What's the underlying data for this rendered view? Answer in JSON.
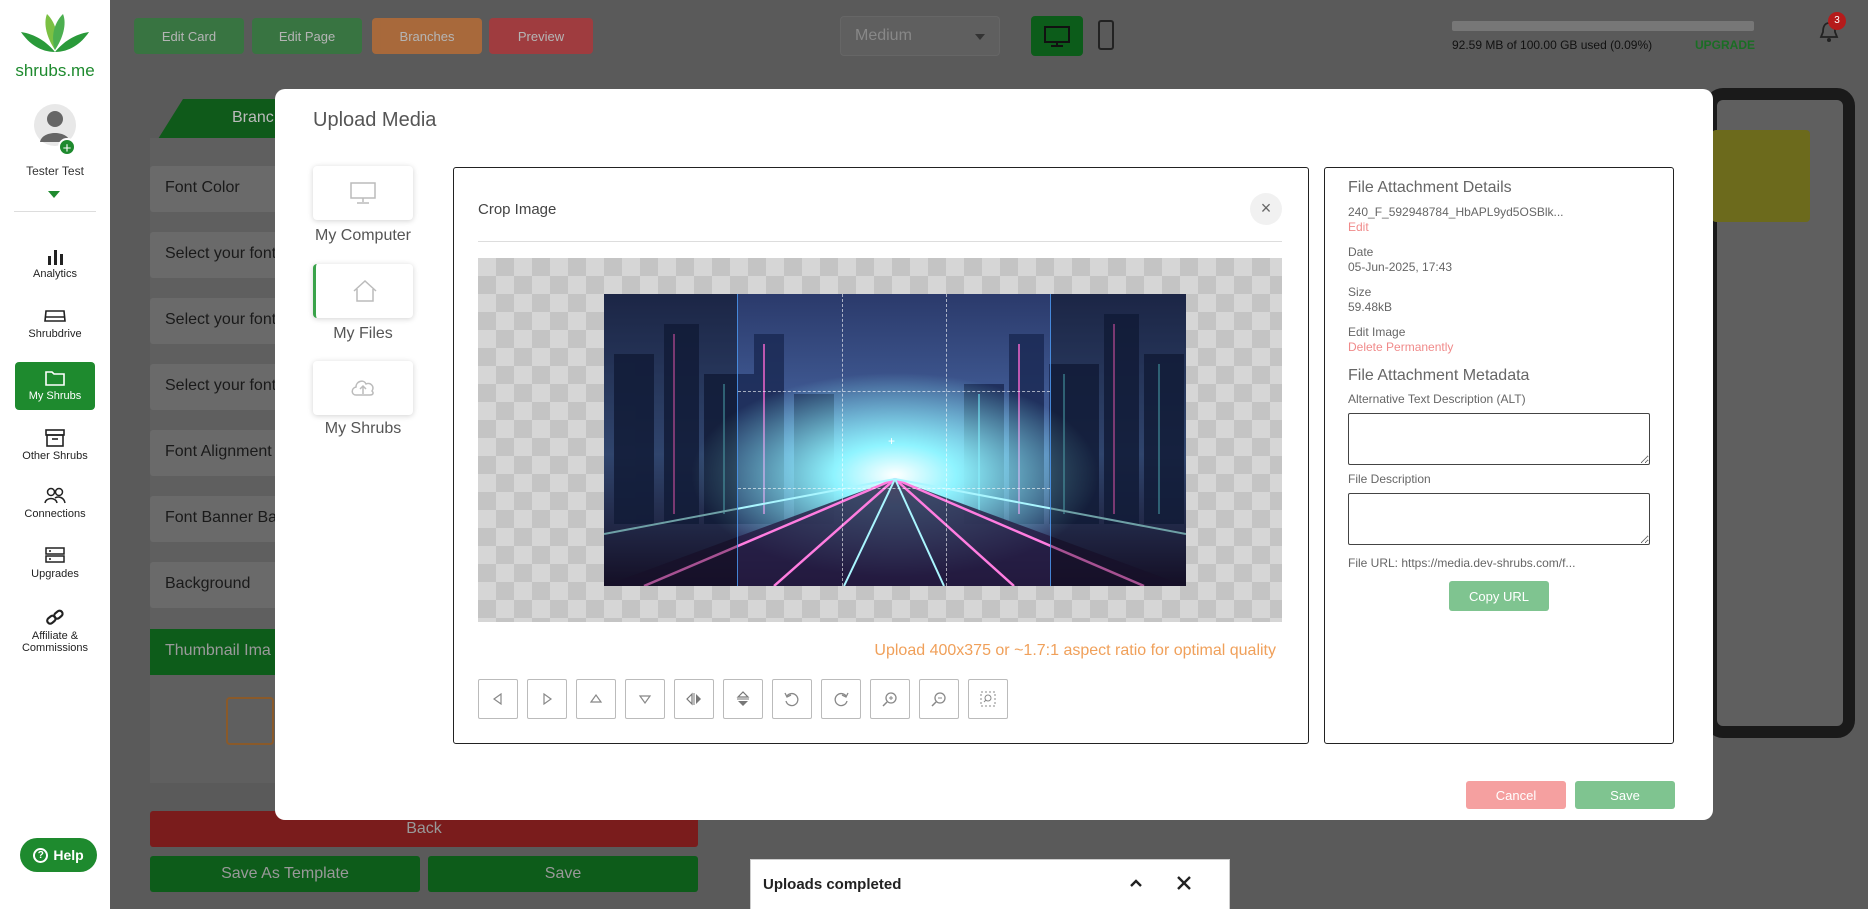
{
  "app": {
    "logo_text": "shrubs.me",
    "brand_color": "#1e8a2e",
    "user_name": "Tester Test"
  },
  "sidebar": {
    "items": [
      {
        "label": "Analytics",
        "icon": "bar-chart-icon"
      },
      {
        "label": "Shrubdrive",
        "icon": "drive-icon"
      },
      {
        "label": "My Shrubs",
        "icon": "folder-icon",
        "active": true
      },
      {
        "label": "Other Shrubs",
        "icon": "archive-icon"
      },
      {
        "label": "Connections",
        "icon": "people-icon"
      },
      {
        "label": "Upgrades",
        "icon": "server-icon"
      },
      {
        "label": "Affiliate &",
        "label2": "Commissions",
        "icon": "link-icon"
      }
    ],
    "help_label": "Help"
  },
  "topbar": {
    "edit_card": "Edit Card",
    "edit_page": "Edit Page",
    "branches": "Branches",
    "preview": "Preview",
    "size_value": "Medium",
    "storage_text": "92.59 MB of 100.00 GB used (0.09%)",
    "storage_percent": 0.09,
    "upgrade_label": "UPGRADE",
    "notification_count": "3"
  },
  "editor": {
    "branch_tab": "Branc",
    "fields": [
      "Font Color",
      "Select your font",
      "Select your font",
      "Select your font",
      "Font Alignment",
      "Font Banner Ba",
      "Background"
    ],
    "thumbnail_header": "Thumbnail Ima",
    "back_label": "Back",
    "save_template_label": "Save As Template",
    "save_label": "Save"
  },
  "modal": {
    "title": "Upload Media",
    "sources": [
      {
        "label": "My Computer",
        "icon": "monitor-icon"
      },
      {
        "label": "My Files",
        "icon": "home-icon",
        "active": true
      },
      {
        "label": "My Shrubs",
        "icon": "cloud-upload-icon"
      }
    ],
    "crop": {
      "title": "Crop Image",
      "hint": "Upload 400x375 or ~1.7:1 aspect ratio for optimal quality",
      "tools": [
        "move-left-icon",
        "move-right-icon",
        "move-up-icon",
        "move-down-icon",
        "flip-horizontal-icon",
        "flip-vertical-icon",
        "rotate-left-icon",
        "rotate-right-icon",
        "zoom-in-icon",
        "zoom-out-icon",
        "crop-reset-icon"
      ]
    },
    "details": {
      "heading": "File Attachment Details",
      "file_name": "240_F_592948784_HbAPL9yd5OSBlk...",
      "edit_link": "Edit",
      "date_label": "Date",
      "date_value": "05-Jun-2025, 17:43",
      "size_label": "Size",
      "size_value": "59.48kB",
      "edit_image_label": "Edit Image",
      "delete_link": "Delete Permanently",
      "metadata_heading": "File Attachment Metadata",
      "alt_label": "Alternative Text Description (ALT)",
      "alt_value": "",
      "desc_label": "File Description",
      "desc_value": "",
      "url_text": "File URL: https://media.dev-shrubs.com/f...",
      "copy_url_label": "Copy URL"
    },
    "cancel_label": "Cancel",
    "save_label": "Save"
  },
  "toast": {
    "text": "Uploads completed"
  }
}
